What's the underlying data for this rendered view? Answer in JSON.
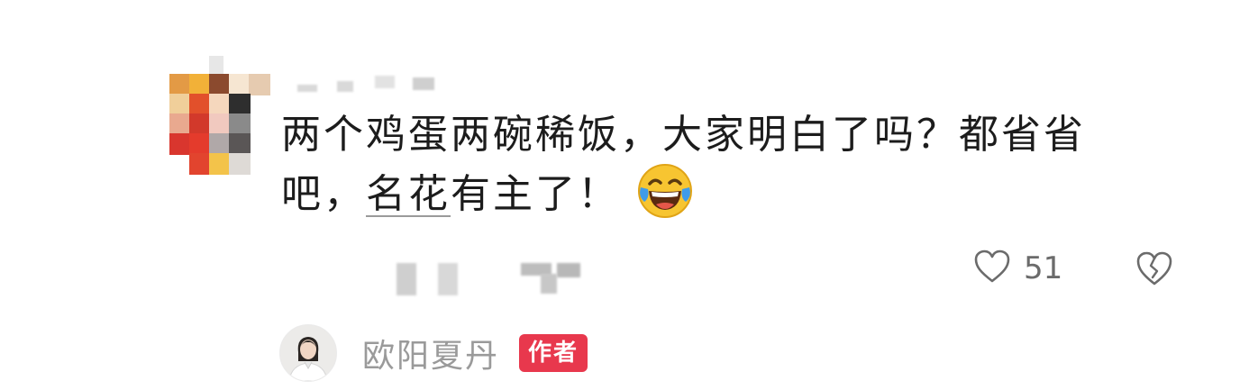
{
  "comment": {
    "avatar_icon": "mosaic-avatar",
    "text_line1": "两个鸡蛋两碗稀饭，大家明白了吗？都省省",
    "text_line2_prefix": "吧，",
    "text_line2_keyword": "名花",
    "text_line2_suffix": "有主了！",
    "emoji": "laughing-crying-emoji",
    "like_count": "51",
    "like_icon": "heart-outline-icon",
    "dislike_icon": "broken-heart-icon"
  },
  "reply": {
    "author_name": "欧阳夏丹",
    "author_badge": "作者",
    "avatar_icon": "author-avatar"
  },
  "colors": {
    "badge": "#e8384d",
    "meta_text": "#6b6b6b",
    "author_name": "#9a9a9a"
  }
}
